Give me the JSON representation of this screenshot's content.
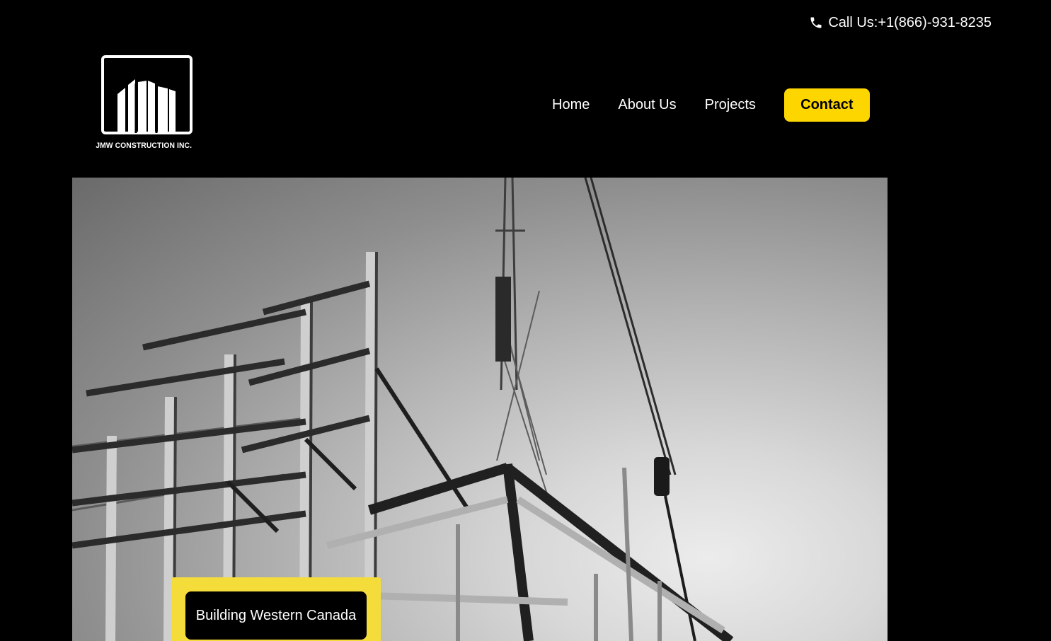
{
  "header": {
    "phone_label": "Call Us:+1(866)-931-8235",
    "phone_icon": "phone-icon"
  },
  "logo": {
    "company_name": "JMW CONSTRUCTION INC."
  },
  "nav": {
    "items": [
      {
        "label": "Home"
      },
      {
        "label": "About Us"
      },
      {
        "label": "Projects"
      }
    ],
    "contact_label": "Contact"
  },
  "hero": {
    "image_alt": "Black and white photo of steel building frame and crane",
    "tagline": "Building Western Canada"
  },
  "colors": {
    "background": "#000000",
    "accent": "#FDD600",
    "tagline_frame": "#F4DC3A",
    "text": "#FFFFFF"
  }
}
